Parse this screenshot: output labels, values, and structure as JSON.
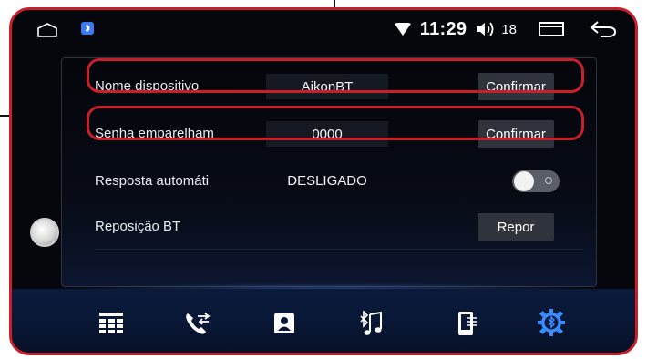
{
  "status": {
    "time": "11:29",
    "volume_level": "18"
  },
  "settings": {
    "rows": [
      {
        "label": "Nome dispositivo",
        "value": "AikonBT",
        "button": "Confirmar"
      },
      {
        "label": "Senha emparelham",
        "value": "0000",
        "button": "Confirmar"
      },
      {
        "label": "Resposta automáti",
        "value": "DESLIGADO",
        "toggle_on": false
      },
      {
        "label": "Reposição BT",
        "button": "Repor"
      }
    ]
  },
  "dock": {
    "items": [
      "keypad-icon",
      "call-log-icon",
      "contacts-icon",
      "bluetooth-music-icon",
      "phone-transfer-icon",
      "bluetooth-settings-icon"
    ],
    "active": "bluetooth-settings-icon"
  },
  "colors": {
    "highlight": "#c8202a",
    "accent_blue": "#3a8cff",
    "button_bg": "#2f343c"
  }
}
